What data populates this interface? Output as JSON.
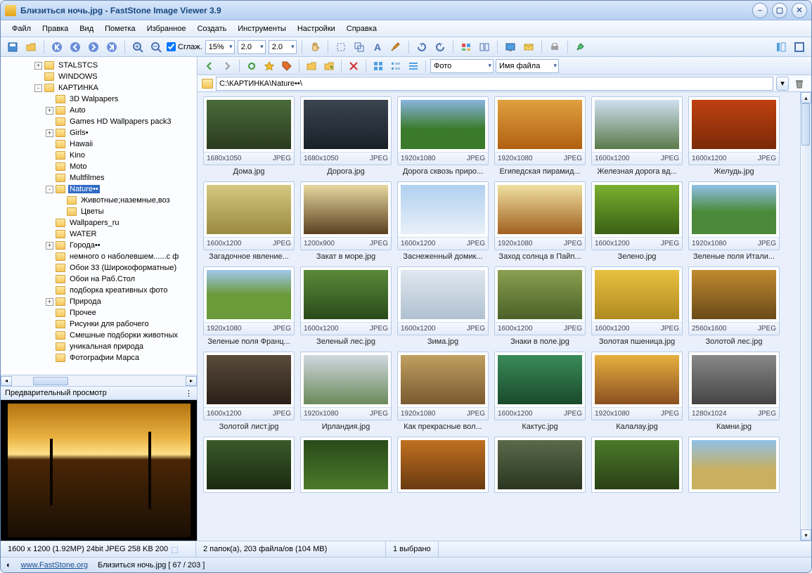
{
  "title": "Близиться ночь.jpg  -  FastStone Image Viewer 3.9",
  "menu": [
    "Файл",
    "Правка",
    "Вид",
    "Пометка",
    "Избранное",
    "Создать",
    "Инструменты",
    "Настройки",
    "Справка"
  ],
  "toolbar1": {
    "smooth_label": "Сглаж.",
    "zoom": "15%",
    "val1": "2.0",
    "val2": "2.0"
  },
  "toolbar2": {
    "sort1": "Фото",
    "sort2": "Имя файла"
  },
  "path": "C:\\КАРТИНКА\\Nature••\\",
  "tree": [
    {
      "d": 1,
      "exp": "+",
      "label": "STALSTCS"
    },
    {
      "d": 1,
      "exp": "",
      "label": "WINDOWS"
    },
    {
      "d": 1,
      "exp": "-",
      "label": "КАРТИНКА"
    },
    {
      "d": 2,
      "exp": "",
      "label": "3D Walpapers"
    },
    {
      "d": 2,
      "exp": "+",
      "label": "Auto"
    },
    {
      "d": 2,
      "exp": "",
      "label": "Games HD Wallpapers pack3"
    },
    {
      "d": 2,
      "exp": "+",
      "label": "Girls•"
    },
    {
      "d": 2,
      "exp": "",
      "label": "Hawaii"
    },
    {
      "d": 2,
      "exp": "",
      "label": "Kino"
    },
    {
      "d": 2,
      "exp": "",
      "label": "Moto"
    },
    {
      "d": 2,
      "exp": "",
      "label": "Multfilmes"
    },
    {
      "d": 2,
      "exp": "-",
      "label": "Nature••",
      "sel": true
    },
    {
      "d": 3,
      "exp": "",
      "label": "Животные;наземные,воз"
    },
    {
      "d": 3,
      "exp": "",
      "label": "Цветы"
    },
    {
      "d": 2,
      "exp": "",
      "label": "Wallpapers_ru"
    },
    {
      "d": 2,
      "exp": "",
      "label": "WATER"
    },
    {
      "d": 2,
      "exp": "+",
      "label": "Города••"
    },
    {
      "d": 2,
      "exp": "",
      "label": "немного о наболевшем......с ф"
    },
    {
      "d": 2,
      "exp": "",
      "label": "Обои 33 (Широкоформатные)"
    },
    {
      "d": 2,
      "exp": "",
      "label": "Обои на Раб.Стол"
    },
    {
      "d": 2,
      "exp": "",
      "label": "подборка креативных фото"
    },
    {
      "d": 2,
      "exp": "+",
      "label": "Природа"
    },
    {
      "d": 2,
      "exp": "",
      "label": "Прочее"
    },
    {
      "d": 2,
      "exp": "",
      "label": "Рисунки для рабочего"
    },
    {
      "d": 2,
      "exp": "",
      "label": "Смешные подборки животных"
    },
    {
      "d": 2,
      "exp": "",
      "label": "уникальная природа"
    },
    {
      "d": 2,
      "exp": "",
      "label": "Фотографии Марса"
    }
  ],
  "preview_label": "Предварительный просмотр",
  "thumbs": [
    {
      "res": "1680x1050",
      "fmt": "JPEG",
      "name": "Дома.jpg",
      "bg": "linear-gradient(#4a6b3a,#2a3b1f)"
    },
    {
      "res": "1680x1050",
      "fmt": "JPEG",
      "name": "Дорога.jpg",
      "bg": "linear-gradient(#3a4550,#1a2028)"
    },
    {
      "res": "1920x1080",
      "fmt": "JPEG",
      "name": "Дорога сквозь приро...",
      "bg": "linear-gradient(#8ab5e0,#3a7a2a 60%)"
    },
    {
      "res": "1920x1080",
      "fmt": "JPEG",
      "name": "Египедская пирамид...",
      "bg": "linear-gradient(#e0a040,#b06010)"
    },
    {
      "res": "1600x1200",
      "fmt": "JPEG",
      "name": "Железная дорога вд...",
      "bg": "linear-gradient(#d0e0f0,#5a7a4a)"
    },
    {
      "res": "1600x1200",
      "fmt": "JPEG",
      "name": "Желудь.jpg",
      "bg": "linear-gradient(#c04010,#7a2a08)"
    },
    {
      "res": "1600x1200",
      "fmt": "JPEG",
      "name": "Загадочное явление...",
      "bg": "linear-gradient(#d5c880,#9a8a40)"
    },
    {
      "res": "1200x900",
      "fmt": "JPEG",
      "name": "Закат в море.jpg",
      "bg": "linear-gradient(#e8d8a0,#5a4020)"
    },
    {
      "res": "1600x1200",
      "fmt": "JPEG",
      "name": "Заснеженный домик...",
      "bg": "linear-gradient(#b0d0f0,#e8f0f8)"
    },
    {
      "res": "1920x1080",
      "fmt": "JPEG",
      "name": "Заход солнца в Пайп...",
      "bg": "linear-gradient(#f0e0a0,#a06020)"
    },
    {
      "res": "1600x1200",
      "fmt": "JPEG",
      "name": "Зелено.jpg",
      "bg": "linear-gradient(#7ab030,#3a6015)"
    },
    {
      "res": "1920x1080",
      "fmt": "JPEG",
      "name": "Зеленые поля Итали...",
      "bg": "linear-gradient(#90c0e8,#4a8a3a 55%)"
    },
    {
      "res": "1920x1080",
      "fmt": "JPEG",
      "name": "Зеленые поля Франц...",
      "bg": "linear-gradient(#a0c8f0,#6a9a3a 50%)"
    },
    {
      "res": "1600x1200",
      "fmt": "JPEG",
      "name": "Зеленый лес.jpg",
      "bg": "linear-gradient(#5a8a3a,#2a4a1a)"
    },
    {
      "res": "1600x1200",
      "fmt": "JPEG",
      "name": "Зима.jpg",
      "bg": "linear-gradient(#e0e8f0,#b0c0d0)"
    },
    {
      "res": "1600x1200",
      "fmt": "JPEG",
      "name": "Знаки в поле.jpg",
      "bg": "linear-gradient(#8aa050,#4a6028)"
    },
    {
      "res": "1600x1200",
      "fmt": "JPEG",
      "name": "Золотая пшеница.jpg",
      "bg": "linear-gradient(#e8c040,#b08a20)"
    },
    {
      "res": "2560x1600",
      "fmt": "JPEG",
      "name": "Золотой лес.jpg",
      "bg": "linear-gradient(#c08a30,#6a4a18)"
    },
    {
      "res": "1600x1200",
      "fmt": "JPEG",
      "name": "Золотой лист.jpg",
      "bg": "linear-gradient(#5a4a3a,#2a2018)"
    },
    {
      "res": "1920x1080",
      "fmt": "JPEG",
      "name": "Ирландия.jpg",
      "bg": "linear-gradient(#d0d8e0,#6a8a5a)"
    },
    {
      "res": "1920x1080",
      "fmt": "JPEG",
      "name": "Как прекрасные вол...",
      "bg": "linear-gradient(#c0a060,#7a5a30)"
    },
    {
      "res": "1600x1200",
      "fmt": "JPEG",
      "name": "Кактус.jpg",
      "bg": "linear-gradient(#3a8a5a,#1a4a2a)"
    },
    {
      "res": "1920x1080",
      "fmt": "JPEG",
      "name": "Калалау.jpg",
      "bg": "linear-gradient(#e8b040,#8a5020)"
    },
    {
      "res": "1280x1024",
      "fmt": "JPEG",
      "name": "Камни.jpg",
      "bg": "linear-gradient(#888,#444)"
    },
    {
      "res": "",
      "fmt": "",
      "name": "",
      "bg": "linear-gradient(#3a5a2a,#1a2a10)"
    },
    {
      "res": "",
      "fmt": "",
      "name": "",
      "bg": "linear-gradient(#2a4a1a,#4a7a2a)"
    },
    {
      "res": "",
      "fmt": "",
      "name": "",
      "bg": "linear-gradient(#c07020,#6a3a10)"
    },
    {
      "res": "",
      "fmt": "",
      "name": "",
      "bg": "linear-gradient(#5a6a4a,#2a3520)"
    },
    {
      "res": "",
      "fmt": "",
      "name": "",
      "bg": "linear-gradient(#4a7a2a,#2a4015)"
    },
    {
      "res": "",
      "fmt": "",
      "name": "",
      "bg": "linear-gradient(#90c0e8,#c8b060 60%)"
    }
  ],
  "status": {
    "left": "1600 x 1200 (1.92MP)  24bit JPEG  258 KB  200",
    "mid": "2 папок(а), 203 файла/ов (104 MB)",
    "sel": "1 выбрано"
  },
  "footer": {
    "url": "www.FastStone.org",
    "info": "Близиться ночь.jpg [ 67 / 203 ]"
  }
}
